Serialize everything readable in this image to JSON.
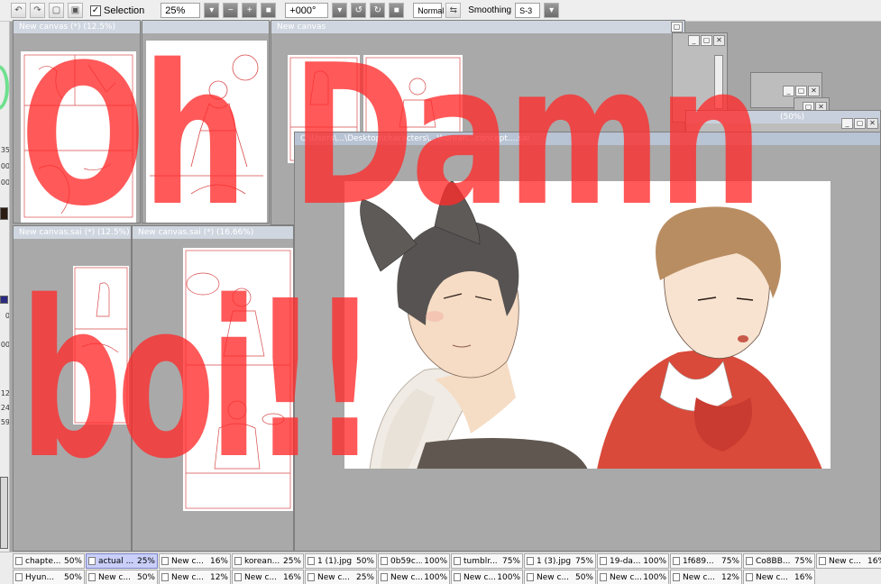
{
  "toolbar": {
    "selection_label": "Selection",
    "selection_checked": "✓",
    "zoom": "25%",
    "rotation": "+000°",
    "blend_mode": "Normal",
    "smoothing_label": "Smoothing",
    "smoothing_value": "S-3"
  },
  "left_strip": {
    "numbers": [
      "35",
      "00",
      "00",
      "0",
      "12",
      "24",
      "59",
      "00"
    ]
  },
  "windows": {
    "storyboard_top_title": "New canvas (*) (12.5%)",
    "sketch_top_title": "",
    "new_canvas_top_title": "New canvas",
    "story_bottom_title": "New canvas.sai (*) (12.5%)",
    "canvas_bottom_title": "New canvas.sai (*) (16.66%)",
    "main_title": "C:\\Users\\...\\Desktop\\characters\\...\\korean...concept....sai",
    "back_title": "(50%)"
  },
  "overlay_text": {
    "line1": "Oh Damn",
    "line2": "boi!!"
  },
  "tabs_row1": [
    {
      "name": "chapte...",
      "pct": "50%"
    },
    {
      "name": "actual ...",
      "pct": "25%",
      "selected": true
    },
    {
      "name": "New c...",
      "pct": "16%"
    },
    {
      "name": "korean...",
      "pct": "25%"
    },
    {
      "name": "1 (1).jpg",
      "pct": "50%"
    },
    {
      "name": "0b59c...",
      "pct": "100%"
    },
    {
      "name": "tumblr...",
      "pct": "75%"
    },
    {
      "name": "1 (3).jpg",
      "pct": "75%"
    },
    {
      "name": "19-da...",
      "pct": "100%"
    },
    {
      "name": "1f689...",
      "pct": "75%"
    },
    {
      "name": "Co8BB...",
      "pct": "75%"
    },
    {
      "name": "New c...",
      "pct": "16%"
    }
  ],
  "tabs_row2": [
    {
      "name": "Hyun...",
      "pct": "50%"
    },
    {
      "name": "New c...",
      "pct": "50%"
    },
    {
      "name": "New c...",
      "pct": "12%"
    },
    {
      "name": "New c...",
      "pct": "16%"
    },
    {
      "name": "New c...",
      "pct": "25%"
    },
    {
      "name": "New c...",
      "pct": "100%"
    },
    {
      "name": "New c...",
      "pct": "100%"
    },
    {
      "name": "New c...",
      "pct": "50%"
    },
    {
      "name": "New c...",
      "pct": "100%"
    },
    {
      "name": "New c...",
      "pct": "12%"
    },
    {
      "name": "New c...",
      "pct": "16%"
    }
  ]
}
